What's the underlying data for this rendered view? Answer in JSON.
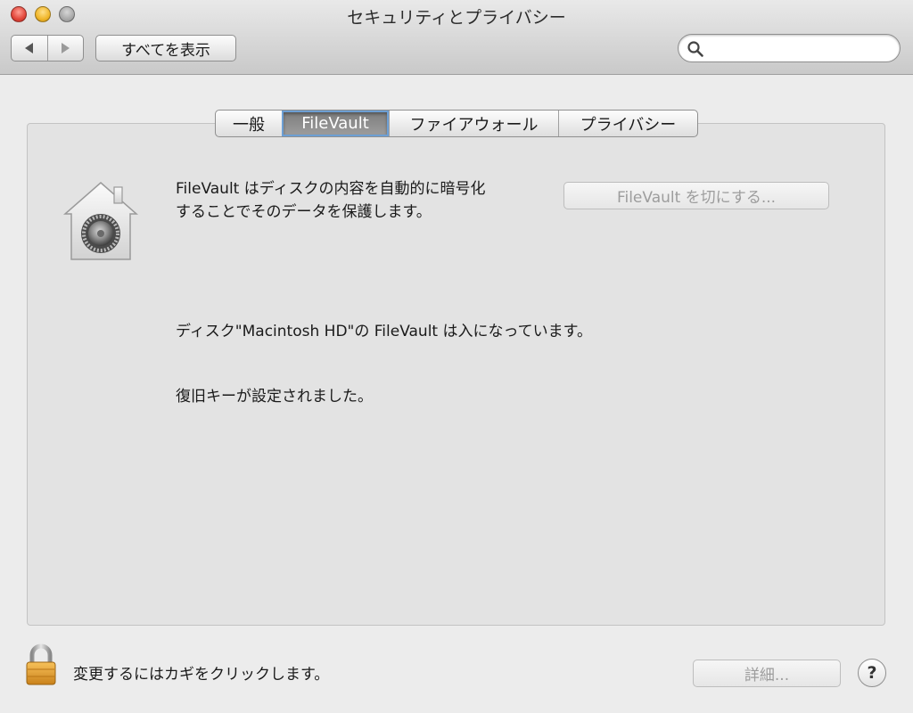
{
  "window": {
    "title": "セキュリティとプライバシー"
  },
  "toolbar": {
    "back_icon": "chevron-left-icon",
    "forward_icon": "chevron-right-icon",
    "show_all_label": "すべてを表示",
    "search": {
      "placeholder": "",
      "value": ""
    }
  },
  "tabs": [
    {
      "label": "一般",
      "active": false
    },
    {
      "label": "FileVault",
      "active": true
    },
    {
      "label": "ファイアウォール",
      "active": false
    },
    {
      "label": "プライバシー",
      "active": false
    }
  ],
  "filevault": {
    "icon": "filevault-house-safe-icon",
    "description_line1": "FileVault はディスクの内容を自動的に暗号化",
    "description_line2": "することでそのデータを保護します。",
    "turn_off_button": "FileVault を切にする...",
    "status_line": "ディスク\"Macintosh HD\"の FileVault は入になっています。",
    "recovery_key_status": "復旧キーが設定されました。"
  },
  "footer": {
    "lock_icon": "lock-icon",
    "lock_text": "変更するにはカギをクリックします。",
    "advanced_button": "詳細...",
    "help_label": "?"
  },
  "colors": {
    "window_bg": "#ececec",
    "panel_bg": "#e3e3e3",
    "active_tab_bg": "#8a8a8a",
    "active_tab_focus": "#6d9fd4",
    "disabled_text": "#9d9d9d",
    "close_light": "#e2463a",
    "minimize_light": "#f0b62a",
    "zoom_light": "#a9a9a9"
  }
}
